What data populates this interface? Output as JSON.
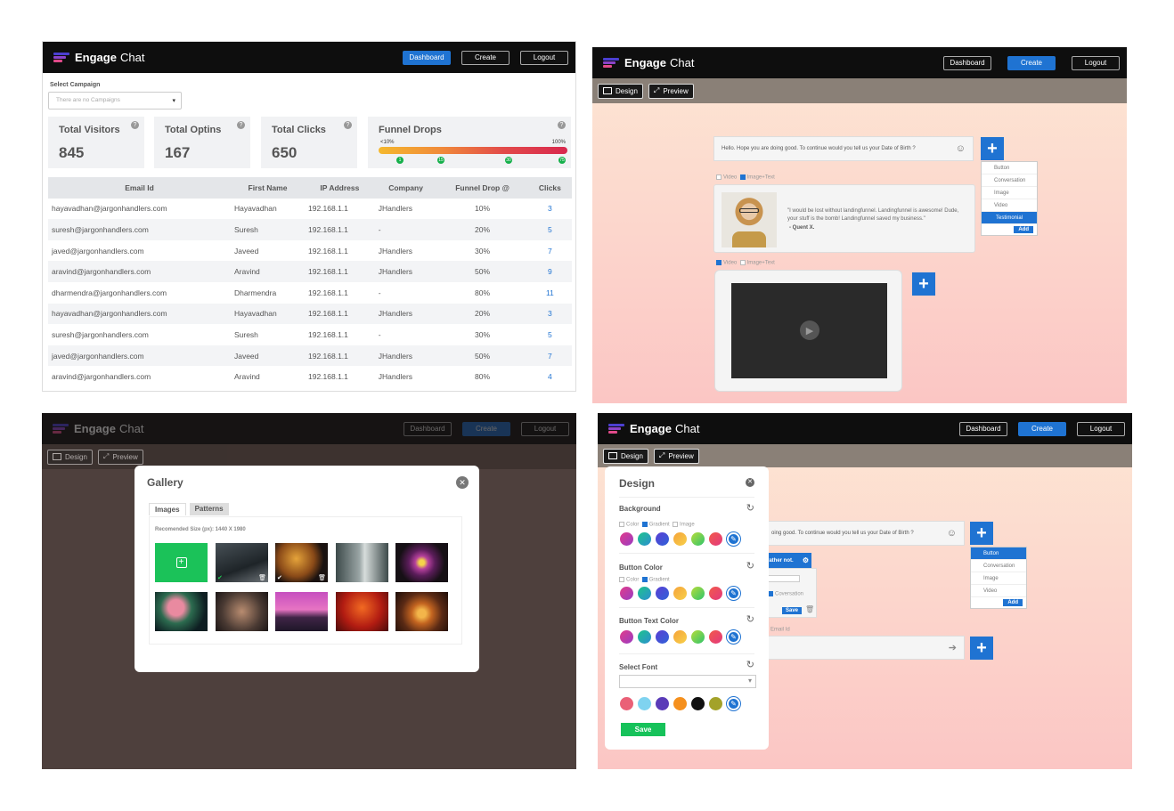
{
  "brand": {
    "name_bold": "Engage",
    "name_light": "Chat"
  },
  "nav": {
    "dashboard": "Dashboard",
    "create": "Create",
    "logout": "Logout"
  },
  "subnav": {
    "design": "Design",
    "preview": "Preview"
  },
  "dashboard": {
    "select_campaign_label": "Select Campaign",
    "select_campaign_placeholder": "There are no Campaigns",
    "stats": [
      {
        "label": "Total Visitors",
        "value": "845"
      },
      {
        "label": "Total Optins",
        "value": "167"
      },
      {
        "label": "Total Clicks",
        "value": "650"
      }
    ],
    "funnel": {
      "label": "Funnel Drops",
      "min": "<10%",
      "max": "100%",
      "markers": [
        "1",
        "15",
        "30",
        "75"
      ]
    },
    "columns": [
      "Email Id",
      "First Name",
      "IP Address",
      "Company",
      "Funnel Drop @",
      "Clicks"
    ],
    "rows": [
      [
        "hayavadhan@jargonhandlers.com",
        "Hayavadhan",
        "192.168.1.1",
        "JHandlers",
        "10%",
        "3"
      ],
      [
        "suresh@jargonhandlers.com",
        "Suresh",
        "192.168.1.1",
        "-",
        "20%",
        "5"
      ],
      [
        "javed@jargonhandlers.com",
        "Javeed",
        "192.168.1.1",
        "JHandlers",
        "30%",
        "7"
      ],
      [
        "aravind@jargonhandlers.com",
        "Aravind",
        "192.168.1.1",
        "JHandlers",
        "50%",
        "9"
      ],
      [
        "dharmendra@jargonhandlers.com",
        "Dharmendra",
        "192.168.1.1",
        "-",
        "80%",
        "11"
      ],
      [
        "hayavadhan@jargonhandlers.com",
        "Hayavadhan",
        "192.168.1.1",
        "JHandlers",
        "20%",
        "3"
      ],
      [
        "suresh@jargonhandlers.com",
        "Suresh",
        "192.168.1.1",
        "-",
        "30%",
        "5"
      ],
      [
        "javed@jargonhandlers.com",
        "Javeed",
        "192.168.1.1",
        "JHandlers",
        "50%",
        "7"
      ],
      [
        "aravind@jargonhandlers.com",
        "Aravind",
        "192.168.1.1",
        "JHandlers",
        "80%",
        "4"
      ]
    ]
  },
  "builder": {
    "message": "Hello. Hope you are doing good. To continue would you tell us your Date of Birth ?",
    "message_partial": "oing good. To continue would you tell us your Date of Birth ?",
    "opt_video": "Video",
    "opt_imagetext": "Image+Text",
    "menu": [
      "Button",
      "Conversation",
      "Image",
      "Video",
      "Testimonial"
    ],
    "add": "Add",
    "testimonial_quote": "\"I would be lost without landingfunnel. Landingfunnel is awesome! Dude, your stuff is the bomb! Landingfunnel saved my business.\"",
    "testimonial_author": "- Quent X.",
    "partial_button": "rather not.",
    "partial_conversation": "Coversation",
    "save_small": "Save",
    "email_id": "Email Id"
  },
  "gallery": {
    "title": "Gallery",
    "tabs": [
      "Images",
      "Patterns"
    ],
    "recommended": "Recomended Size (px): 1440 X 1980"
  },
  "design_panel": {
    "title": "Design",
    "background": "Background",
    "bg_opts": [
      "Color",
      "Gradient",
      "Image"
    ],
    "button_color": "Button Color",
    "btn_opts": [
      "Color",
      "Gradient"
    ],
    "button_text_color": "Button Text Color",
    "select_font": "Select Font",
    "save": "Save"
  },
  "colors": {
    "accent": "#1f73d2",
    "green": "#00c853",
    "topbar": "#0e0e0e"
  }
}
